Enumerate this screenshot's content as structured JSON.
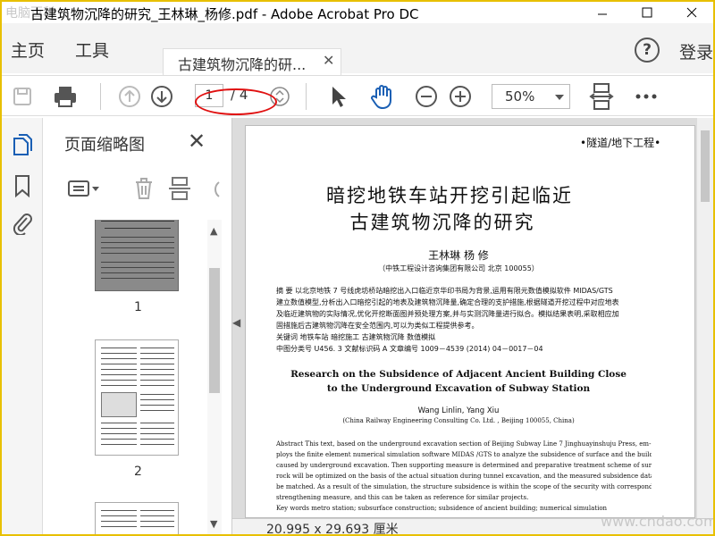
{
  "window": {
    "watermark_top": "电脑百科",
    "title": "古建筑物沉降的研究_王林琳_杨修.pdf - Adobe Acrobat Pro DC"
  },
  "menu": {
    "home": "主页",
    "tools": "工具",
    "tab_label": "古建筑物沉降的研...",
    "login": "登录",
    "help": "?"
  },
  "toolbar": {
    "current_page": "1",
    "total_pages": "/ 4",
    "zoom": "50%"
  },
  "thumbnails_panel": {
    "title": "页面缩略图",
    "pages": [
      "1",
      "2"
    ]
  },
  "document": {
    "section": "•隧道/地下工程•",
    "title_line1": "暗挖地铁车站开挖引起临近",
    "title_line2": "古建筑物沉降的研究",
    "authors": "王林琳    杨   修",
    "affiliation": "（中铁工程设计咨询集团有限公司    北京    100055）",
    "abstract_lines": [
      "摘    要    以北京地铁 7 号线虎坊桥站暗挖出入口临近京华印书局为背景,运用有限元数值模拟软件 MIDAS/GTS",
      "建立数值模型,分析出入口暗挖引起的地表及建筑物沉降量,确定合理的支护措施,根据隧道开挖过程中对应地表",
      "及临近建筑物的实际情况,优化开挖断面图并预处理方案,并与实测沉降量进行拟合。模拟结果表明,采取相应加",
      "固措施后古建筑物沉降在安全范围内,可以为类似工程提供参考。",
      "关键词    地铁车站    暗挖施工    古建筑物沉降    数值模拟",
      "中图分类号    U456. 3         文献标识码    A         文章编号    1009－4539 (2014) 04－0017－04"
    ],
    "en_title_line1": "Research on the Subsidence of Adjacent Ancient Building Close",
    "en_title_line2": "to the Underground Excavation of Subway Station",
    "en_authors": "Wang Linlin, Yang Xiu",
    "en_affiliation": "(China Railway Engineering Consulting Co.  Ltd. , Beijing 100055, China)",
    "en_abstract_lines": [
      "Abstract   This text, based on the underground excavation section of Beijing Subway Line 7 Jinghuayinshuju Press, em-",
      "ploys the finite element numerical simulation software MIDAS /GTS to analyze the subsidence of surface and the building",
      "caused by underground excavation.  Then supporting measure is determined and preparative treatment scheme of surrounding",
      "rock will be optimized on the basis of the actual situation during tunnel excavation, and the measured subsidence data will",
      "be matched.  As a result of the simulation, the structure subsidence is within the scope of the security with corresponding",
      "strengthening measure, and this can be taken as reference for similar projects.",
      "Key words   metro station; subsurface construction; subsidence of ancient building; numerical simulation"
    ]
  },
  "status": {
    "page_size": "20.995 x 29.693 厘米"
  },
  "watermark_bottom": "www.cndao.com",
  "colors": {
    "annotation": "#e01010",
    "frame": "#e8c000"
  }
}
